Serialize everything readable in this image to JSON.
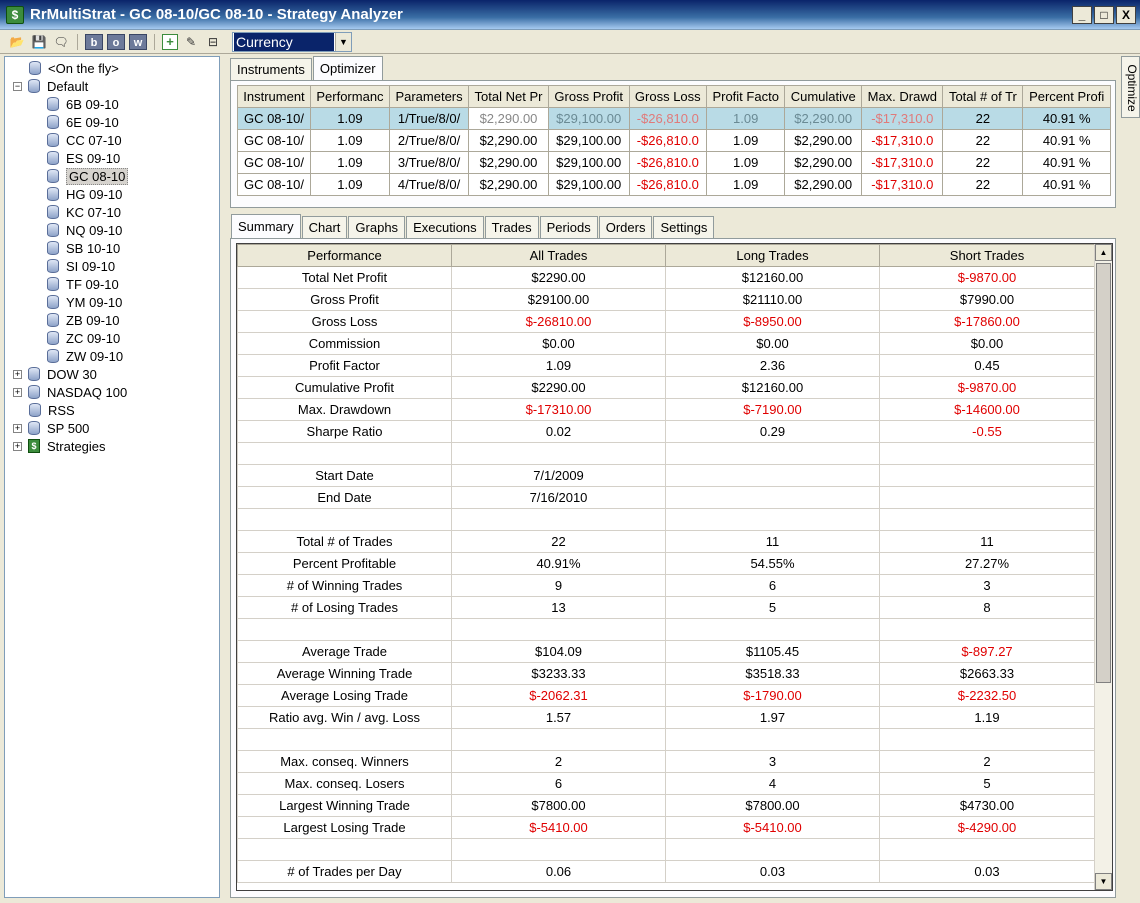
{
  "window": {
    "title": "RrMultiStrat - GC 08-10/GC 08-10 - Strategy Analyzer",
    "minimize": "_",
    "maximize": "□",
    "close": "X"
  },
  "toolbar": {
    "letters": [
      "b",
      "o",
      "w"
    ],
    "combo_value": "Currency"
  },
  "tree": [
    {
      "label": "<On the fly>",
      "level": 1,
      "expander": "",
      "icon": "db"
    },
    {
      "label": "Default",
      "level": 0,
      "expander": "−",
      "icon": "db"
    },
    {
      "label": "6B 09-10",
      "level": 2,
      "expander": "",
      "icon": "db"
    },
    {
      "label": "6E 09-10",
      "level": 2,
      "expander": "",
      "icon": "db"
    },
    {
      "label": "CC 07-10",
      "level": 2,
      "expander": "",
      "icon": "db"
    },
    {
      "label": "ES 09-10",
      "level": 2,
      "expander": "",
      "icon": "db"
    },
    {
      "label": "GC 08-10",
      "level": 2,
      "expander": "",
      "icon": "db",
      "selected": true
    },
    {
      "label": "HG 09-10",
      "level": 2,
      "expander": "",
      "icon": "db"
    },
    {
      "label": "KC 07-10",
      "level": 2,
      "expander": "",
      "icon": "db"
    },
    {
      "label": "NQ 09-10",
      "level": 2,
      "expander": "",
      "icon": "db"
    },
    {
      "label": "SB 10-10",
      "level": 2,
      "expander": "",
      "icon": "db"
    },
    {
      "label": "SI 09-10",
      "level": 2,
      "expander": "",
      "icon": "db"
    },
    {
      "label": "TF 09-10",
      "level": 2,
      "expander": "",
      "icon": "db"
    },
    {
      "label": "YM 09-10",
      "level": 2,
      "expander": "",
      "icon": "db"
    },
    {
      "label": "ZB 09-10",
      "level": 2,
      "expander": "",
      "icon": "db"
    },
    {
      "label": "ZC 09-10",
      "level": 2,
      "expander": "",
      "icon": "db"
    },
    {
      "label": "ZW 09-10",
      "level": 2,
      "expander": "",
      "icon": "db"
    },
    {
      "label": "DOW 30",
      "level": 0,
      "expander": "+",
      "icon": "db"
    },
    {
      "label": "NASDAQ 100",
      "level": 0,
      "expander": "+",
      "icon": "db"
    },
    {
      "label": "RSS",
      "level": 1,
      "expander": "",
      "icon": "db"
    },
    {
      "label": "SP 500",
      "level": 0,
      "expander": "+",
      "icon": "db"
    },
    {
      "label": "Strategies",
      "level": 0,
      "expander": "+",
      "icon": "strat"
    }
  ],
  "side_tab": "Optimize",
  "top_tabs": [
    "Instruments",
    "Optimizer"
  ],
  "top_tabs_active": 1,
  "optimizer": {
    "columns": [
      "Instrument",
      "Performanc",
      "Parameters",
      "Total Net Pr",
      "Gross Profit",
      "Gross Loss",
      "Profit Facto",
      "Cumulative",
      "Max. Drawd",
      "Total # of Tr",
      "Percent Profi"
    ],
    "rows": [
      [
        "GC 08-10/",
        "1.09",
        "1/True/8/0/",
        "$2,290.00",
        "$29,100.00",
        "-$26,810.0",
        "1.09",
        "$2,290.00",
        "-$17,310.0",
        "22",
        "40.91 %"
      ],
      [
        "GC 08-10/",
        "1.09",
        "2/True/8/0/",
        "$2,290.00",
        "$29,100.00",
        "-$26,810.0",
        "1.09",
        "$2,290.00",
        "-$17,310.0",
        "22",
        "40.91 %"
      ],
      [
        "GC 08-10/",
        "1.09",
        "3/True/8/0/",
        "$2,290.00",
        "$29,100.00",
        "-$26,810.0",
        "1.09",
        "$2,290.00",
        "-$17,310.0",
        "22",
        "40.91 %"
      ],
      [
        "GC 08-10/",
        "1.09",
        "4/True/8/0/",
        "$2,290.00",
        "$29,100.00",
        "-$26,810.0",
        "1.09",
        "$2,290.00",
        "-$17,310.0",
        "22",
        "40.91 %"
      ]
    ],
    "selected_row": 0
  },
  "bottom_tabs": [
    "Summary",
    "Chart",
    "Graphs",
    "Executions",
    "Trades",
    "Periods",
    "Orders",
    "Settings"
  ],
  "bottom_tabs_active": 0,
  "summary": {
    "columns": [
      "Performance",
      "All Trades",
      "Long Trades",
      "Short Trades"
    ],
    "rows": [
      [
        "Total Net Profit",
        "$2290.00",
        "$12160.00",
        "$-9870.00"
      ],
      [
        "Gross Profit",
        "$29100.00",
        "$21110.00",
        "$7990.00"
      ],
      [
        "Gross Loss",
        "$-26810.00",
        "$-8950.00",
        "$-17860.00"
      ],
      [
        "Commission",
        "$0.00",
        "$0.00",
        "$0.00"
      ],
      [
        "Profit Factor",
        "1.09",
        "2.36",
        "0.45"
      ],
      [
        "Cumulative Profit",
        "$2290.00",
        "$12160.00",
        "$-9870.00"
      ],
      [
        "Max. Drawdown",
        "$-17310.00",
        "$-7190.00",
        "$-14600.00"
      ],
      [
        "Sharpe Ratio",
        "0.02",
        "0.29",
        "-0.55"
      ],
      [
        "",
        "",
        "",
        ""
      ],
      [
        "Start Date",
        "7/1/2009",
        "",
        ""
      ],
      [
        "End Date",
        "7/16/2010",
        "",
        ""
      ],
      [
        "",
        "",
        "",
        ""
      ],
      [
        "Total # of Trades",
        "22",
        "11",
        "11"
      ],
      [
        "Percent Profitable",
        "40.91%",
        "54.55%",
        "27.27%"
      ],
      [
        "# of Winning Trades",
        "9",
        "6",
        "3"
      ],
      [
        "# of Losing Trades",
        "13",
        "5",
        "8"
      ],
      [
        "",
        "",
        "",
        ""
      ],
      [
        "Average Trade",
        "$104.09",
        "$1105.45",
        "$-897.27"
      ],
      [
        "Average Winning Trade",
        "$3233.33",
        "$3518.33",
        "$2663.33"
      ],
      [
        "Average Losing Trade",
        "$-2062.31",
        "$-1790.00",
        "$-2232.50"
      ],
      [
        "Ratio avg. Win / avg. Loss",
        "1.57",
        "1.97",
        "1.19"
      ],
      [
        "",
        "",
        "",
        ""
      ],
      [
        "Max. conseq. Winners",
        "2",
        "3",
        "2"
      ],
      [
        "Max. conseq. Losers",
        "6",
        "4",
        "5"
      ],
      [
        "Largest Winning Trade",
        "$7800.00",
        "$7800.00",
        "$4730.00"
      ],
      [
        "Largest Losing Trade",
        "$-5410.00",
        "$-5410.00",
        "$-4290.00"
      ],
      [
        "",
        "",
        "",
        ""
      ],
      [
        "# of Trades per Day",
        "0.06",
        "0.03",
        "0.03"
      ]
    ]
  },
  "colors": {
    "negative": "#e00000",
    "selection": "#b9dbe6"
  }
}
